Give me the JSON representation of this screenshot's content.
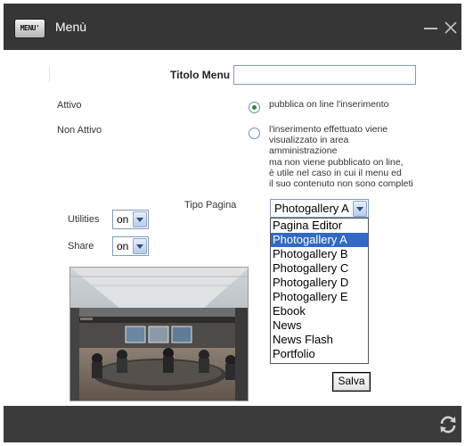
{
  "window": {
    "title": "Menù",
    "menu_badge": "MENU'",
    "icons": [
      "minimize-icon",
      "close-icon",
      "refresh-icon"
    ]
  },
  "form": {
    "titolo_label": "Titolo Menu",
    "titolo_value": "",
    "attivo_label": "Attivo",
    "attivo_desc": "pubblica on line l'inserimento",
    "non_attivo_label": "Non Attivo",
    "non_attivo_desc": [
      "l'inserimento effettuato viene",
      "visualizzato in area",
      "amministrazione",
      "ma non viene pubblicato on line,",
      "è utile nel caso in cui il menu ed",
      "il suo contenuto non sono completi"
    ],
    "selected_status": "Attivo",
    "tipo_pagina_label": "Tipo Pagina",
    "tipo_pagina_value": "Photogallery A",
    "tipo_pagina_options": [
      "Pagina Editor",
      "Photogallery A",
      "Photogallery B",
      "Photogallery C",
      "Photogallery D",
      "Photogallery E",
      "Ebook",
      "News",
      "News Flash",
      "Portfolio"
    ],
    "utilities_label": "Utilities",
    "utilities_value": "on",
    "share_label": "Share",
    "share_value": "on",
    "save_label": "Salva"
  },
  "colors": {
    "titlebar": "#363636",
    "selected_option": "#3169c6",
    "radio_checked": "#2e8b2e"
  }
}
